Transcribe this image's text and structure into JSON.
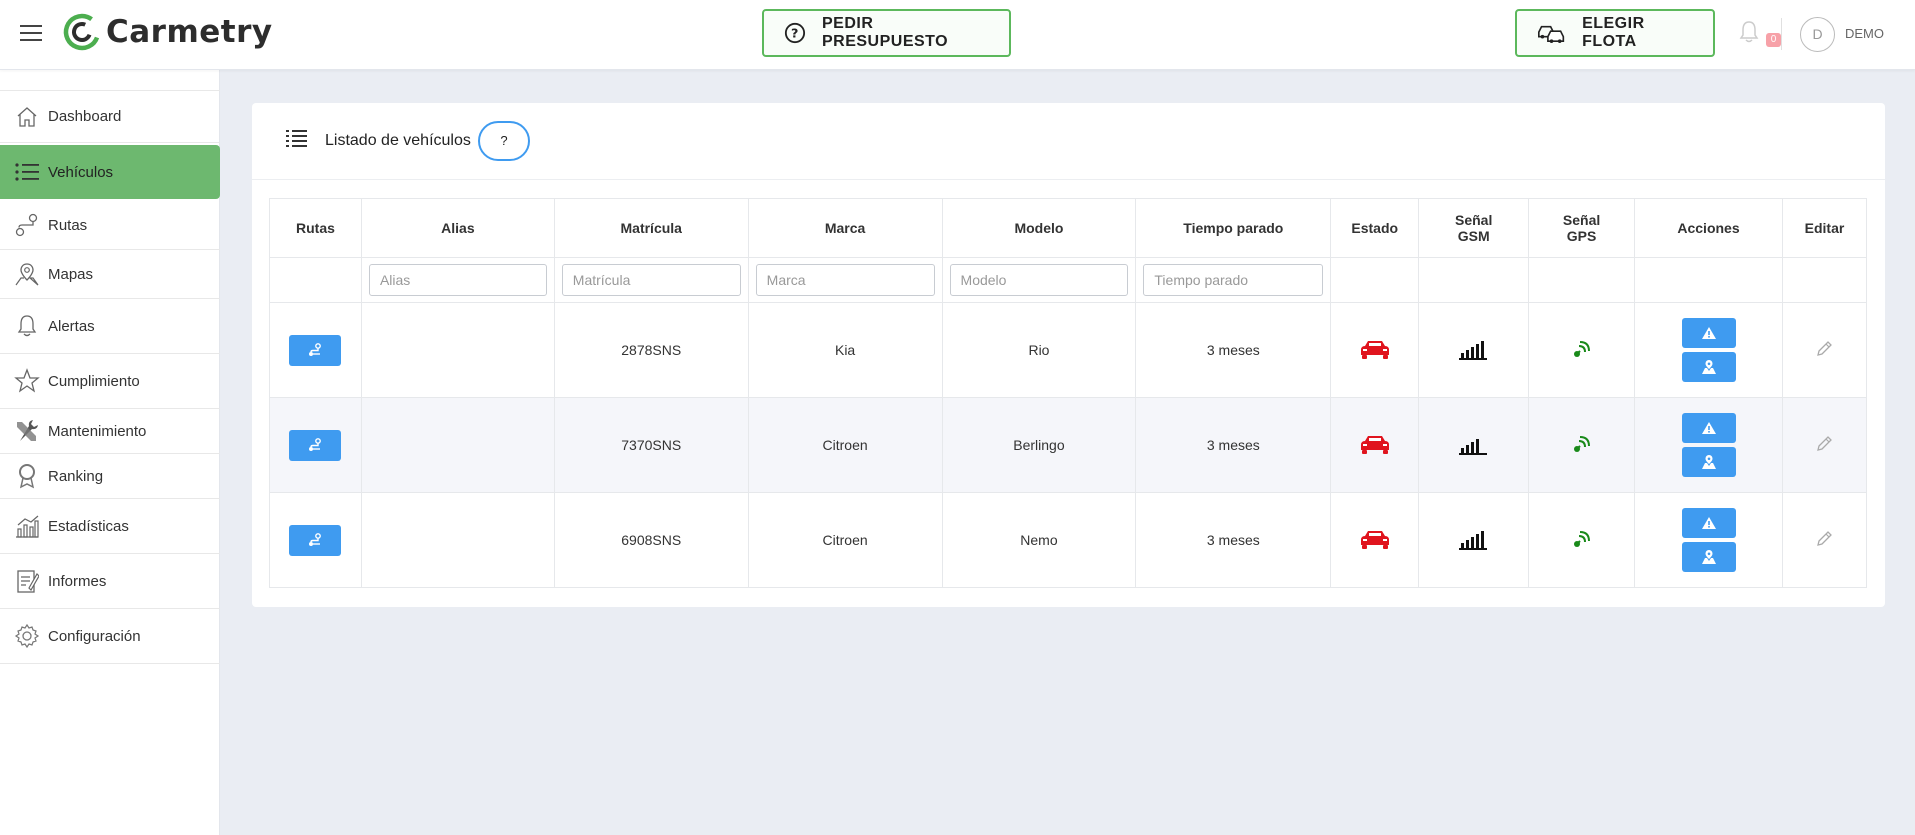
{
  "app": {
    "name": "Carmetry"
  },
  "header": {
    "budget_button": "PEDIR PRESUPUESTO",
    "fleet_button": "ELEGIR FLOTA",
    "notifications_count": "0",
    "user_initial": "D",
    "user_name": "DEMO"
  },
  "sidebar": {
    "items": [
      {
        "label": "Dashboard",
        "icon": "home-icon"
      },
      {
        "label": "Vehículos",
        "icon": "list-icon",
        "active": true
      },
      {
        "label": "Rutas",
        "icon": "route-icon"
      },
      {
        "label": "Mapas",
        "icon": "map-pin-icon"
      },
      {
        "label": "Alertas",
        "icon": "bell-icon"
      },
      {
        "label": "Cumplimiento",
        "icon": "star-icon"
      },
      {
        "label": "Mantenimiento",
        "icon": "wrench-icon"
      },
      {
        "label": "Ranking",
        "icon": "medal-icon"
      },
      {
        "label": "Estadísticas",
        "icon": "chart-icon"
      },
      {
        "label": "Informes",
        "icon": "report-icon"
      },
      {
        "label": "Configuración",
        "icon": "gear-icon"
      }
    ]
  },
  "panel": {
    "title": "Listado de vehículos",
    "help_label": "?"
  },
  "table": {
    "headers": {
      "rutas": "Rutas",
      "alias": "Alias",
      "matricula": "Matrícula",
      "marca": "Marca",
      "modelo": "Modelo",
      "tiempo": "Tiempo parado",
      "estado": "Estado",
      "gsm_line1": "Señal",
      "gsm_line2": "GSM",
      "gps_line1": "Señal",
      "gps_line2": "GPS",
      "acciones": "Acciones",
      "editar": "Editar"
    },
    "filters": {
      "alias": "Alias",
      "matricula": "Matrícula",
      "marca": "Marca",
      "modelo": "Modelo",
      "tiempo": "Tiempo parado"
    },
    "rows": [
      {
        "alias": "",
        "matricula": "2878SNS",
        "marca": "Kia",
        "modelo": "Rio",
        "tiempo": "3 meses",
        "gsm_bars": 5
      },
      {
        "alias": "",
        "matricula": "7370SNS",
        "marca": "Citroen",
        "modelo": "Berlingo",
        "tiempo": "3 meses",
        "gsm_bars": 4
      },
      {
        "alias": "",
        "matricula": "6908SNS",
        "marca": "Citroen",
        "modelo": "Nemo",
        "tiempo": "3 meses",
        "gsm_bars": 5
      }
    ]
  },
  "colors": {
    "brand_green": "#5cb85c",
    "sidebar_active": "#6db86f",
    "action_blue": "#3f9bf0",
    "status_red": "#e0141e",
    "gps_green": "#1a8a1a"
  }
}
